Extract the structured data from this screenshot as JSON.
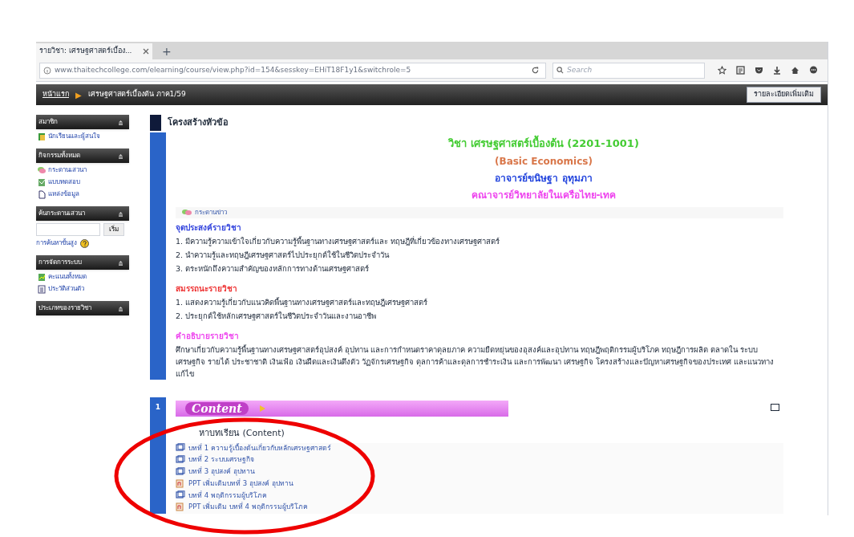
{
  "browser": {
    "tab_title": "รายวิชา: เศรษฐศาสตร์เบื้อง...",
    "new_tab": "+",
    "url": "www.thaitechcollege.com/elearning/course/view.php?id=154&sesskey=EHiT18F1y1&switchrole=5",
    "search_placeholder": "Search"
  },
  "navbar": {
    "home": "หน้าแรก",
    "separator": "▶",
    "course": "เศรษฐศาสตร์เบื้องต้น ภาค1/59",
    "button": "รายละเอียดเพิ่มเติม"
  },
  "sidebar": [
    {
      "kind": "list",
      "title": "สมาชิก",
      "items": [
        {
          "kind": "people",
          "label": "นักเรียนและผู้สนใจ"
        }
      ]
    },
    {
      "kind": "list",
      "title": "กิจกรรมทั้งหมด",
      "items": [
        {
          "kind": "forum",
          "label": "กระดานเสวนา"
        },
        {
          "kind": "quiz",
          "label": "แบบทดสอบ"
        },
        {
          "kind": "resource",
          "label": "แหล่งข้อมูล"
        }
      ]
    },
    {
      "kind": "search",
      "title": "ค้นกระดานเสวนา",
      "button": "เริ่ม",
      "link": "การค้นหาขั้นสูง"
    },
    {
      "kind": "list",
      "title": "การจัดการระบบ",
      "items": [
        {
          "kind": "grades",
          "label": "คะแนนทั้งหมด"
        },
        {
          "kind": "profile",
          "label": "ประวัติส่วนตัว"
        }
      ]
    },
    {
      "kind": "list",
      "title": "ประเภทของรายวิชา"
    }
  ],
  "main": {
    "heading": "โครงสร้างหัวข้อ",
    "course_titles": [
      {
        "text": "วิชา เศรษฐศาสตร์เบื้องต้น (2201-1001)",
        "color": "#44cc33"
      },
      {
        "text": "(Basic Economics)",
        "color": "#d9774a"
      },
      {
        "text": "อาจารย์ขนิษฐา อุทุมภา",
        "color": "#2244dd"
      },
      {
        "text": "คณาจารย์วิทยาลัยในเครือไทย-เทค",
        "color": "#ee44ee"
      }
    ],
    "news_link": "กระดานข่าว",
    "sections": [
      {
        "title": "จุดประสงค์รายวิชา",
        "color": "#3344dd",
        "lines": [
          "1. มีความรู้ความเข้าใจเกี่ยวกับความรู้พื้นฐานทางเศรษฐศาสตร์และ ทฤษฎีที่เกี่ยวข้องทางเศรษฐศาสตร์",
          "2. นำความรู้และทฤษฎีเศรษฐศาสตร์ไปประยุกต์ใช้ในชีวิตประจำวัน",
          "3. ตระหนักถึงความสำคัญของหลักการทางด้านเศรษฐศาสตร์"
        ]
      },
      {
        "title": "สมรรถนะรายวิชา",
        "color": "#ee3333",
        "lines": [
          "1. แสดงความรู้เกี่ยวกับแนวคิดพื้นฐานทางเศรษฐศาสตร์และทฤษฎีเศรษฐศาสตร์",
          "2. ประยุกต์ใช้หลักเศรษฐศาสตร์ในชีวิตประจำวันและงานอาชีพ"
        ]
      },
      {
        "title": "คำอธิบายรายวิชา",
        "color": "#ee44ee",
        "lines": [
          "ศึกษาเกี่ยวกับความรู้พื้นฐานทางเศรษฐศาสตร์อุปสงค์ อุปทาน และการกำหนดราคาดุลยภาค ความยืดหยุ่นของอุสงค์และอุปทาน ทฤษฎีพฤติกรรมผู้บริโภค ทฤษฎีการผลิต ตลาดใน ระบบเศรษฐกิจ รายได้ ประชาชาติ เงินเฟ้อ เงินฝืดและเงินตึงตัว วัฏจักรเศรษฐกิจ ดุลการค้าและดุลการชำระเงิน และการพัฒนา เศรษฐกิจ โครงสร้างและปัญหาเศรษฐกิจของประเทศ และแนวทางแก้ไข"
        ]
      }
    ]
  },
  "topic": {
    "number": "1",
    "banner": "Content",
    "heading": "หาบทเรียน (Content)",
    "links": [
      {
        "kind": "page",
        "label": "บทที่ 1 ความรู้เบื้องต้นเกี่ยวกับหลักเศรษฐศาสตร์"
      },
      {
        "kind": "page",
        "label": "บทที่ 2 ระบบเศรษฐกิจ"
      },
      {
        "kind": "page",
        "label": "บทที่ 3 อุปสงค์ อุปทาน"
      },
      {
        "kind": "ppt",
        "label": "PPT เพิ่มเติมบทที่ 3 อุปสงค์ อุปทาน"
      },
      {
        "kind": "page",
        "label": "บทที่ 4 พฤติกรรมผู้บริโภค"
      },
      {
        "kind": "ppt",
        "label": "PPT เพิ่มเติม บทที่ 4 พฤติกรรมผู้บริโภค"
      }
    ]
  }
}
